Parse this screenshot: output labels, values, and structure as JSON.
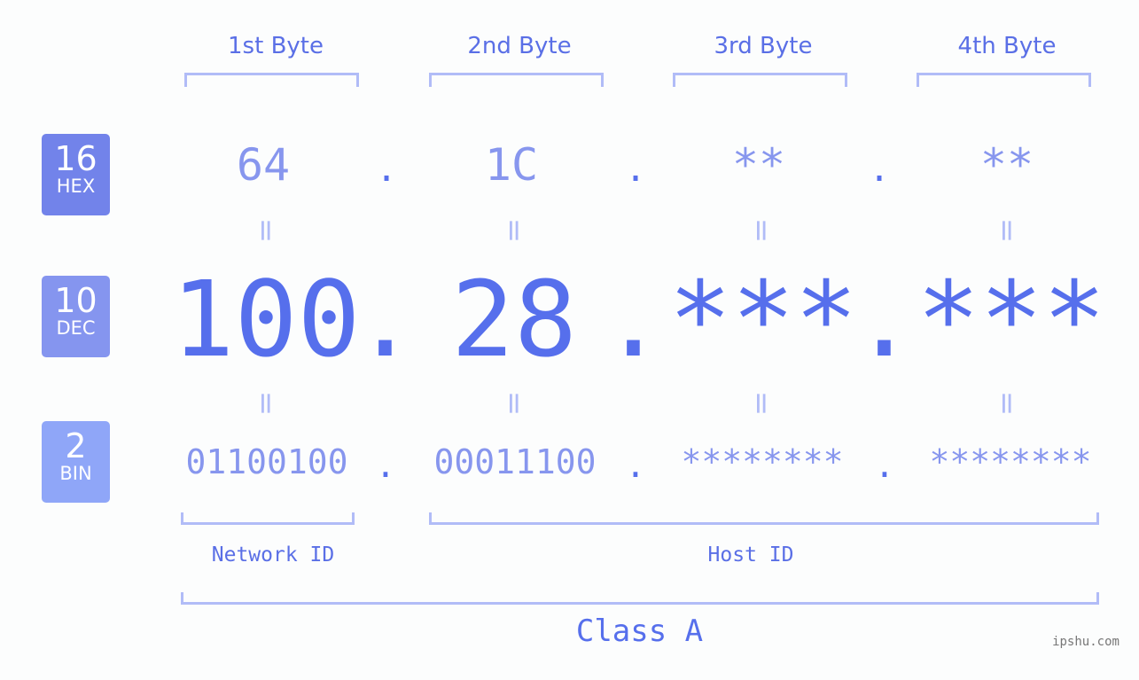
{
  "badges": [
    {
      "number": "16",
      "label": "HEX",
      "color": "#7283ea"
    },
    {
      "number": "10",
      "label": "DEC",
      "color": "#8595ef"
    },
    {
      "number": "2",
      "label": "BIN",
      "color": "#8fa6f8"
    }
  ],
  "bytes": [
    {
      "header": "1st Byte",
      "hex": "64",
      "dec": "100",
      "bin": "01100100"
    },
    {
      "header": "2nd Byte",
      "hex": "1C",
      "dec": "28",
      "bin": "00011100"
    },
    {
      "header": "3rd Byte",
      "hex": "**",
      "dec": "***",
      "bin": "********"
    },
    {
      "header": "4th Byte",
      "hex": "**",
      "dec": "***",
      "bin": "********"
    }
  ],
  "separator": ".",
  "equals": "=",
  "network_id_label": "Network ID",
  "host_id_label": "Host ID",
  "class_label": "Class A",
  "watermark": "ipshu.com",
  "colors": {
    "accent": "#566fec",
    "light_accent": "#8796ee",
    "bracket": "#b1bcf7",
    "background": "#fcfdfd"
  }
}
